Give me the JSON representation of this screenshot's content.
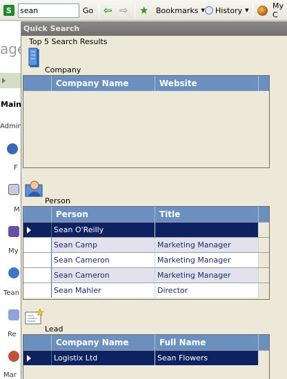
{
  "toolbar": {
    "search_value": "sean",
    "go_label": "Go",
    "bookmarks_label": "Bookmarks",
    "history_label": "History",
    "my_label": "My C"
  },
  "background": {
    "heading_fragment": "age",
    "main_fragment": "Main",
    "items": [
      "Admini",
      "F",
      "M",
      "My",
      "Tean",
      "Re",
      "Mar"
    ]
  },
  "panel": {
    "title": "Quick Search",
    "group_title": "Top 5 Search Results",
    "sections": {
      "company": {
        "label": "Company",
        "columns": [
          "Company Name",
          "Website"
        ],
        "rows": []
      },
      "person": {
        "label": "Person",
        "columns": [
          "Person",
          "Title"
        ],
        "rows": [
          {
            "name": "Sean O'Reilly",
            "title": "",
            "selected": true
          },
          {
            "name": "Sean Camp",
            "title": "Marketing Manager"
          },
          {
            "name": "Sean Cameron",
            "title": "Marketing Manager"
          },
          {
            "name": "Sean Cameron",
            "title": "Marketing Manager"
          },
          {
            "name": "Sean Mahler",
            "title": "Director"
          }
        ]
      },
      "lead": {
        "label": "Lead",
        "columns": [
          "Company Name",
          "Full Name"
        ],
        "rows": [
          {
            "company": "Logistix Ltd",
            "name": "Sean Flowers",
            "selected": true
          }
        ]
      }
    }
  },
  "icons": {
    "search_engine": "s-icon",
    "back": "back-arrow-icon",
    "forward": "forward-arrow-icon",
    "bookmarks": "star-icon",
    "history": "clock-icon",
    "addon": "cog-icon",
    "company": "building-icon",
    "person": "person-icon",
    "lead": "lead-card-icon"
  },
  "colors": {
    "grid_header": "#6b8fbf",
    "selected_row": "#0e2262",
    "panel_header": "#7a7a7a"
  }
}
